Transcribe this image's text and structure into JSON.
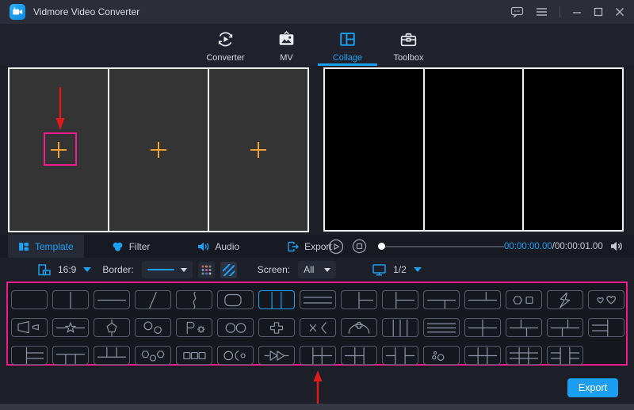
{
  "window": {
    "title": "Vidmore Video Converter"
  },
  "nav": {
    "active": "Collage",
    "tabs": [
      {
        "label": "Converter",
        "icon": "converter-icon"
      },
      {
        "label": "MV",
        "icon": "mv-icon"
      },
      {
        "label": "Collage",
        "icon": "collage-icon"
      },
      {
        "label": "Toolbox",
        "icon": "toolbox-icon"
      }
    ]
  },
  "panel_tabs": {
    "active": "Template",
    "tabs": [
      {
        "label": "Template",
        "icon": "template-icon"
      },
      {
        "label": "Filter",
        "icon": "filter-icon"
      },
      {
        "label": "Audio",
        "icon": "audio-icon"
      },
      {
        "label": "Export",
        "icon": "export-icon"
      }
    ]
  },
  "playback": {
    "elapsed": "00:00:00.00",
    "duration": "/00:00:01.00"
  },
  "toolbar": {
    "aspect_ratio": "16:9",
    "border_label": "Border:",
    "screen_label": "Screen:",
    "screen_value": "All",
    "display_page": "1/2"
  },
  "gallery": {
    "selected_row": 0,
    "selected_index": 6,
    "rows": [
      [
        "single",
        "split-v2",
        "split-h2",
        "diagonal",
        "curve-v",
        "rounded-inset",
        "split-v3",
        "split-h3",
        "col-right-rows",
        "col-narrow-rows",
        "row-bottom-cols",
        "row-top-cols",
        "hex-square",
        "zigzag",
        "hearts"
      ],
      [
        "megaphone",
        "star-line",
        "pentagon-line",
        "circles-offset",
        "flag-gear",
        "two-circles",
        "puzzle",
        "cross-bracket",
        "arch-flower",
        "split-v4",
        "split-h4",
        "grid-2x2",
        "grid-stagger-a",
        "grid-stagger-b",
        "left-rows-col"
      ],
      [
        "col-right-3rows",
        "row-bottom-3cols",
        "row-top-3cols",
        "hex-circle-hex",
        "three-squares",
        "circle-semi-dot",
        "fast-forward",
        "col-grid-a",
        "col-grid-b",
        "col-grid-c",
        "dots",
        "grid-2x3",
        "grid-3x3",
        "grid-3x3-frame"
      ]
    ]
  },
  "footer": {
    "export_label": "Export"
  },
  "colors": {
    "accent": "#1ca0f2",
    "highlight_pink": "#ee1b8c",
    "plus_orange": "#f0a232",
    "arrow_red": "#e01b1b"
  }
}
